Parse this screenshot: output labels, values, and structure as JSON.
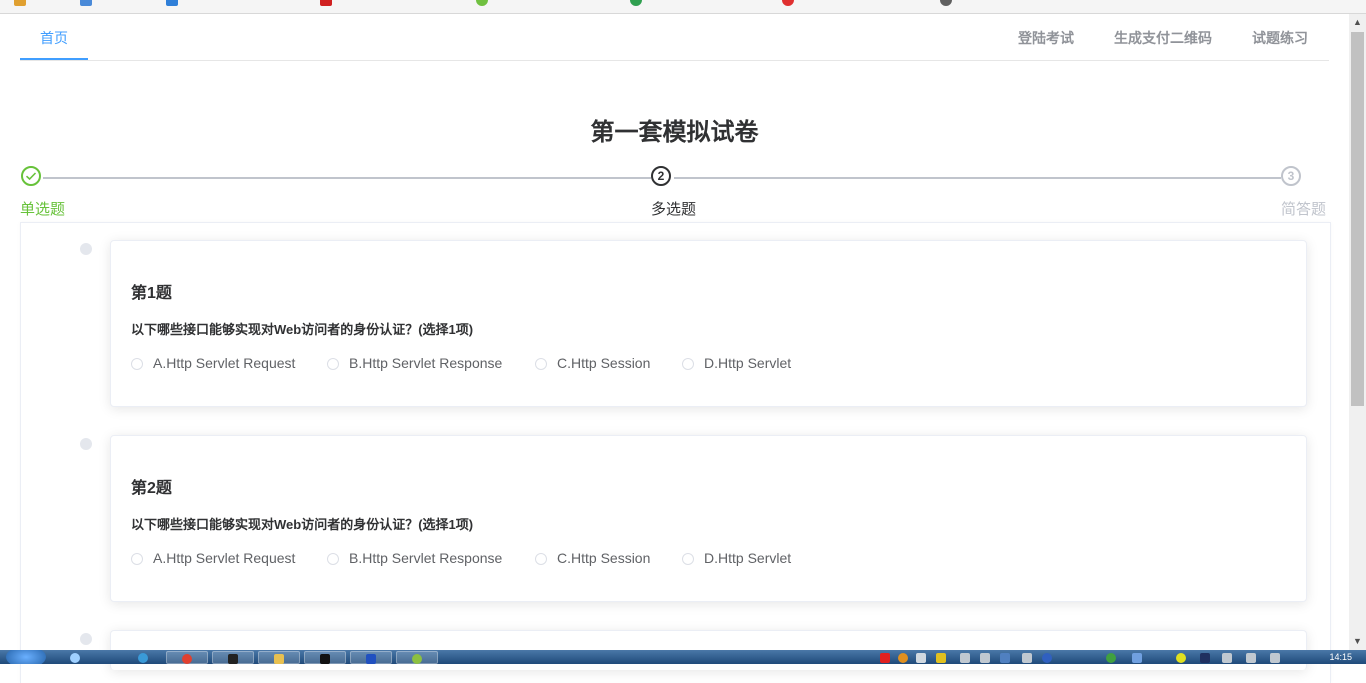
{
  "nav": {
    "home": "首页",
    "login_exam": "登陆考试",
    "generate_qr": "生成支付二维码",
    "practice": "试题练习"
  },
  "page": {
    "title": "第一套模拟试卷"
  },
  "steps": [
    {
      "label": "单选题",
      "status": "done",
      "number": "1"
    },
    {
      "label": "多选题",
      "status": "active",
      "number": "2"
    },
    {
      "label": "简答题",
      "status": "wait",
      "number": "3"
    }
  ],
  "questions": [
    {
      "number_label": "第1题",
      "text": "以下哪些接口能够实现对Web访问者的身份认证？(选择1项)",
      "options": [
        "A.Http Servlet Request",
        "B.Http Servlet Response",
        "C.Http Session",
        "D.Http Servlet"
      ]
    },
    {
      "number_label": "第2题",
      "text": "以下哪些接口能够实现对Web访问者的身份认证？(选择1项)",
      "options": [
        "A.Http Servlet Request",
        "B.Http Servlet Response",
        "C.Http Session",
        "D.Http Servlet"
      ]
    }
  ],
  "taskbar": {
    "time": "14:15"
  },
  "colors": {
    "accent": "#409eff",
    "success": "#67c23a",
    "muted": "#c0c4cc",
    "text": "#303133"
  }
}
